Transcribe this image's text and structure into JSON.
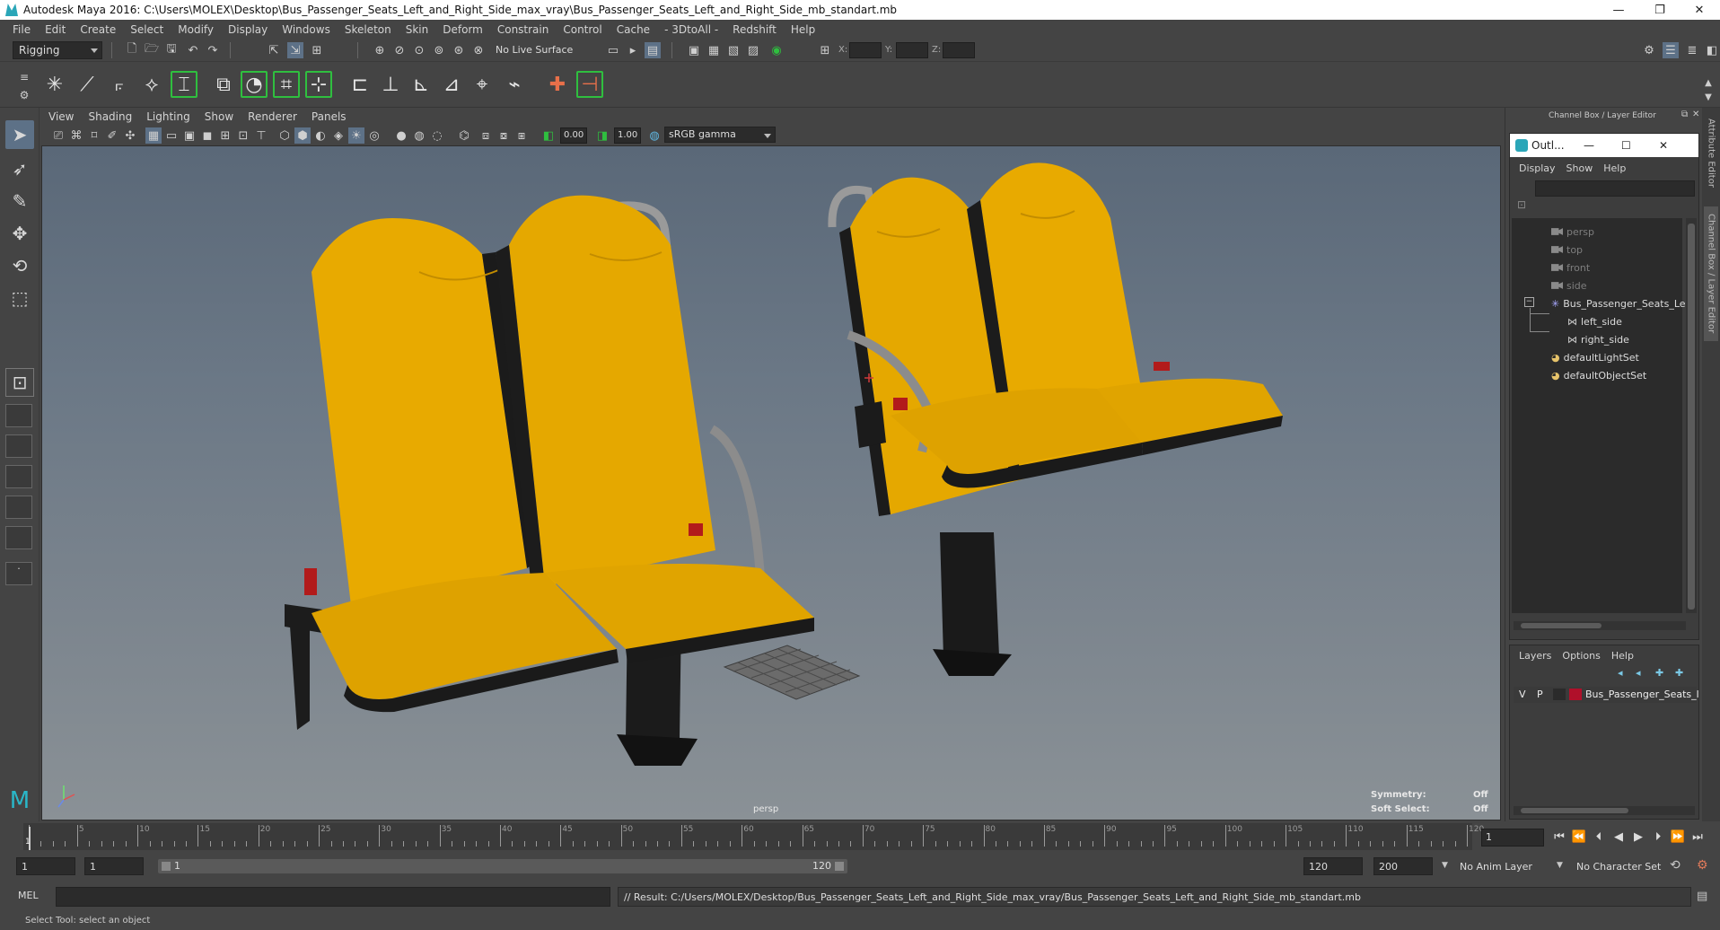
{
  "window": {
    "title": "Autodesk Maya 2016: C:\\Users\\MOLEX\\Desktop\\Bus_Passenger_Seats_Left_and_Right_Side_max_vray\\Bus_Passenger_Seats_Left_and_Right_Side_mb_standart.mb",
    "minimize": "—",
    "restore": "❐",
    "close": "✕"
  },
  "menu": [
    "File",
    "Edit",
    "Create",
    "Select",
    "Modify",
    "Display",
    "Windows",
    "Skeleton",
    "Skin",
    "Deform",
    "Constrain",
    "Control",
    "Cache",
    "- 3DtoAll -",
    "Redshift",
    "Help"
  ],
  "status": {
    "mode": "Rigging",
    "live_surface": "No Live Surface",
    "x_label": "X:",
    "y_label": "Y:",
    "z_label": "Z:"
  },
  "panel_menu": [
    "View",
    "Shading",
    "Lighting",
    "Show",
    "Renderer",
    "Panels"
  ],
  "panel_bar": {
    "value_a": "0.00",
    "value_b": "1.00",
    "color_space": "sRGB gamma"
  },
  "viewport": {
    "camera": "persp",
    "symmetry_label": "Symmetry:",
    "symmetry_value": "Off",
    "soft_select_label": "Soft Select:",
    "soft_select_value": "Off"
  },
  "right_panel": {
    "header": "Channel Box / Layer Editor",
    "side_tab_attr": "Attribute Editor",
    "side_tab_channel": "Channel Box / Layer Editor",
    "outliner": {
      "title": "Outl...",
      "menu": [
        "Display",
        "Show",
        "Help"
      ],
      "nodes": [
        {
          "label": "persp",
          "kind": "camera",
          "depth": 0,
          "dim": true
        },
        {
          "label": "top",
          "kind": "camera",
          "depth": 0,
          "dim": true
        },
        {
          "label": "front",
          "kind": "camera",
          "depth": 0,
          "dim": true
        },
        {
          "label": "side",
          "kind": "camera",
          "depth": 0,
          "dim": true
        },
        {
          "label": "Bus_Passenger_Seats_Le",
          "kind": "group",
          "depth": 0,
          "dim": false
        },
        {
          "label": "left_side",
          "kind": "mesh",
          "depth": 1,
          "dim": false
        },
        {
          "label": "right_side",
          "kind": "mesh",
          "depth": 1,
          "dim": false
        },
        {
          "label": "defaultLightSet",
          "kind": "set",
          "depth": 0,
          "dim": false
        },
        {
          "label": "defaultObjectSet",
          "kind": "set",
          "depth": 0,
          "dim": false
        }
      ]
    },
    "layers": {
      "menu": [
        "Layers",
        "Options",
        "Help"
      ],
      "row": {
        "v": "V",
        "p": "P",
        "name": "Bus_Passenger_Seats_l",
        "color": "#b0102a"
      }
    }
  },
  "timeline": {
    "ticks": [
      1,
      5,
      10,
      15,
      20,
      25,
      30,
      35,
      40,
      45,
      50,
      55,
      60,
      65,
      70,
      75,
      80,
      85,
      90,
      95,
      100,
      105,
      110,
      115,
      120
    ],
    "current_frame": "1"
  },
  "range": {
    "start": "1",
    "playback_start": "1",
    "slider_start": "1",
    "slider_end": "120",
    "playback_end": "120",
    "end": "200",
    "anim_layer": "No Anim Layer",
    "character_set": "No Character Set"
  },
  "command": {
    "label": "MEL",
    "result": "// Result: C:/Users/MOLEX/Desktop/Bus_Passenger_Seats_Left_and_Right_Side_max_vray/Bus_Passenger_Seats_Left_and_Right_Side_mb_standart.mb"
  },
  "help_line": "Select Tool: select an object",
  "colors": {
    "seat": "#e5a800",
    "seat_shadow": "#b78300",
    "frame": "#1c1c1c",
    "accent_green": "#2fbf3f",
    "active_tool": "#5d7187"
  }
}
